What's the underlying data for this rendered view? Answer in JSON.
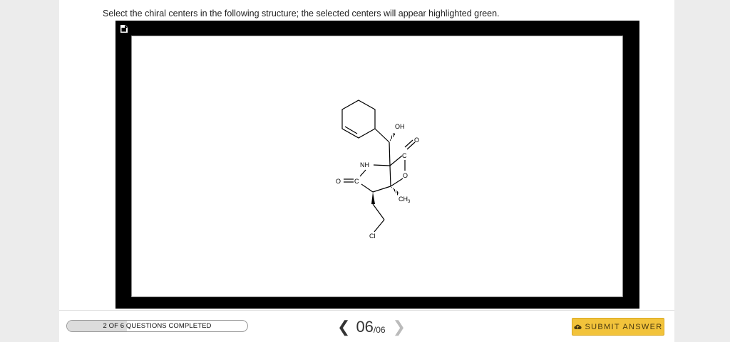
{
  "question": {
    "prompt": "Select the chiral centers in the following structure; the selected centers will appear highlighted green."
  },
  "molecule": {
    "atom_labels": {
      "oh": "OH",
      "nh": "NH",
      "o_carbonyl_left": "O",
      "c_carbonyl_left": "C",
      "o_carbonyl_right": "O",
      "c_carbonyl_right": "C",
      "o_ring": "O",
      "ch3_main": "CH",
      "ch3_sub": "3",
      "cl": "Cl"
    }
  },
  "footer": {
    "progress_label": "2 OF 6 QUESTIONS COMPLETED",
    "progress_fraction": 0.333,
    "current_page": "06",
    "total_pages": "/06",
    "prev_icon": "chevron-left-icon",
    "next_icon": "chevron-right-icon",
    "submit_label": "SUBMIT ANSWER",
    "submit_icon": "cloud-upload-icon"
  },
  "colors": {
    "accent": "#f2c33b",
    "editor_frame": "#000000",
    "background": "#ececec"
  }
}
